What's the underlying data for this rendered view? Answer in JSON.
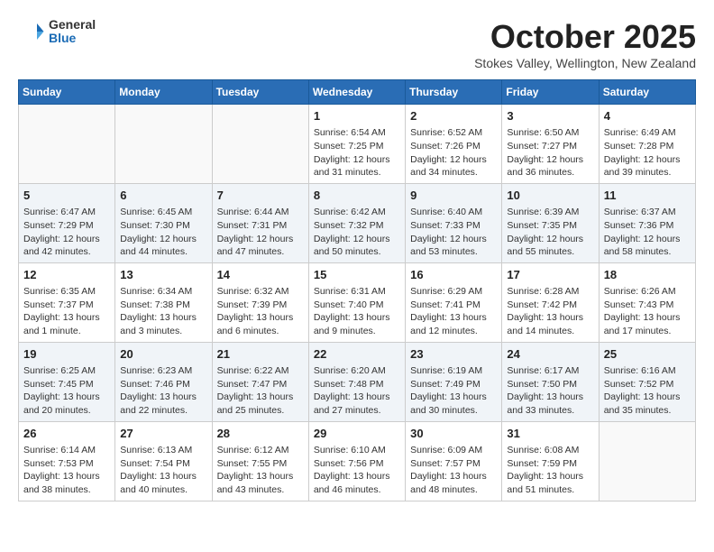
{
  "header": {
    "logo": {
      "line1": "General",
      "line2": "Blue"
    },
    "title": "October 2025",
    "location": "Stokes Valley, Wellington, New Zealand"
  },
  "days_of_week": [
    "Sunday",
    "Monday",
    "Tuesday",
    "Wednesday",
    "Thursday",
    "Friday",
    "Saturday"
  ],
  "weeks": [
    [
      {
        "day": "",
        "info": ""
      },
      {
        "day": "",
        "info": ""
      },
      {
        "day": "",
        "info": ""
      },
      {
        "day": "1",
        "info": "Sunrise: 6:54 AM\nSunset: 7:25 PM\nDaylight: 12 hours\nand 31 minutes."
      },
      {
        "day": "2",
        "info": "Sunrise: 6:52 AM\nSunset: 7:26 PM\nDaylight: 12 hours\nand 34 minutes."
      },
      {
        "day": "3",
        "info": "Sunrise: 6:50 AM\nSunset: 7:27 PM\nDaylight: 12 hours\nand 36 minutes."
      },
      {
        "day": "4",
        "info": "Sunrise: 6:49 AM\nSunset: 7:28 PM\nDaylight: 12 hours\nand 39 minutes."
      }
    ],
    [
      {
        "day": "5",
        "info": "Sunrise: 6:47 AM\nSunset: 7:29 PM\nDaylight: 12 hours\nand 42 minutes."
      },
      {
        "day": "6",
        "info": "Sunrise: 6:45 AM\nSunset: 7:30 PM\nDaylight: 12 hours\nand 44 minutes."
      },
      {
        "day": "7",
        "info": "Sunrise: 6:44 AM\nSunset: 7:31 PM\nDaylight: 12 hours\nand 47 minutes."
      },
      {
        "day": "8",
        "info": "Sunrise: 6:42 AM\nSunset: 7:32 PM\nDaylight: 12 hours\nand 50 minutes."
      },
      {
        "day": "9",
        "info": "Sunrise: 6:40 AM\nSunset: 7:33 PM\nDaylight: 12 hours\nand 53 minutes."
      },
      {
        "day": "10",
        "info": "Sunrise: 6:39 AM\nSunset: 7:35 PM\nDaylight: 12 hours\nand 55 minutes."
      },
      {
        "day": "11",
        "info": "Sunrise: 6:37 AM\nSunset: 7:36 PM\nDaylight: 12 hours\nand 58 minutes."
      }
    ],
    [
      {
        "day": "12",
        "info": "Sunrise: 6:35 AM\nSunset: 7:37 PM\nDaylight: 13 hours\nand 1 minute."
      },
      {
        "day": "13",
        "info": "Sunrise: 6:34 AM\nSunset: 7:38 PM\nDaylight: 13 hours\nand 3 minutes."
      },
      {
        "day": "14",
        "info": "Sunrise: 6:32 AM\nSunset: 7:39 PM\nDaylight: 13 hours\nand 6 minutes."
      },
      {
        "day": "15",
        "info": "Sunrise: 6:31 AM\nSunset: 7:40 PM\nDaylight: 13 hours\nand 9 minutes."
      },
      {
        "day": "16",
        "info": "Sunrise: 6:29 AM\nSunset: 7:41 PM\nDaylight: 13 hours\nand 12 minutes."
      },
      {
        "day": "17",
        "info": "Sunrise: 6:28 AM\nSunset: 7:42 PM\nDaylight: 13 hours\nand 14 minutes."
      },
      {
        "day": "18",
        "info": "Sunrise: 6:26 AM\nSunset: 7:43 PM\nDaylight: 13 hours\nand 17 minutes."
      }
    ],
    [
      {
        "day": "19",
        "info": "Sunrise: 6:25 AM\nSunset: 7:45 PM\nDaylight: 13 hours\nand 20 minutes."
      },
      {
        "day": "20",
        "info": "Sunrise: 6:23 AM\nSunset: 7:46 PM\nDaylight: 13 hours\nand 22 minutes."
      },
      {
        "day": "21",
        "info": "Sunrise: 6:22 AM\nSunset: 7:47 PM\nDaylight: 13 hours\nand 25 minutes."
      },
      {
        "day": "22",
        "info": "Sunrise: 6:20 AM\nSunset: 7:48 PM\nDaylight: 13 hours\nand 27 minutes."
      },
      {
        "day": "23",
        "info": "Sunrise: 6:19 AM\nSunset: 7:49 PM\nDaylight: 13 hours\nand 30 minutes."
      },
      {
        "day": "24",
        "info": "Sunrise: 6:17 AM\nSunset: 7:50 PM\nDaylight: 13 hours\nand 33 minutes."
      },
      {
        "day": "25",
        "info": "Sunrise: 6:16 AM\nSunset: 7:52 PM\nDaylight: 13 hours\nand 35 minutes."
      }
    ],
    [
      {
        "day": "26",
        "info": "Sunrise: 6:14 AM\nSunset: 7:53 PM\nDaylight: 13 hours\nand 38 minutes."
      },
      {
        "day": "27",
        "info": "Sunrise: 6:13 AM\nSunset: 7:54 PM\nDaylight: 13 hours\nand 40 minutes."
      },
      {
        "day": "28",
        "info": "Sunrise: 6:12 AM\nSunset: 7:55 PM\nDaylight: 13 hours\nand 43 minutes."
      },
      {
        "day": "29",
        "info": "Sunrise: 6:10 AM\nSunset: 7:56 PM\nDaylight: 13 hours\nand 46 minutes."
      },
      {
        "day": "30",
        "info": "Sunrise: 6:09 AM\nSunset: 7:57 PM\nDaylight: 13 hours\nand 48 minutes."
      },
      {
        "day": "31",
        "info": "Sunrise: 6:08 AM\nSunset: 7:59 PM\nDaylight: 13 hours\nand 51 minutes."
      },
      {
        "day": "",
        "info": ""
      }
    ]
  ]
}
